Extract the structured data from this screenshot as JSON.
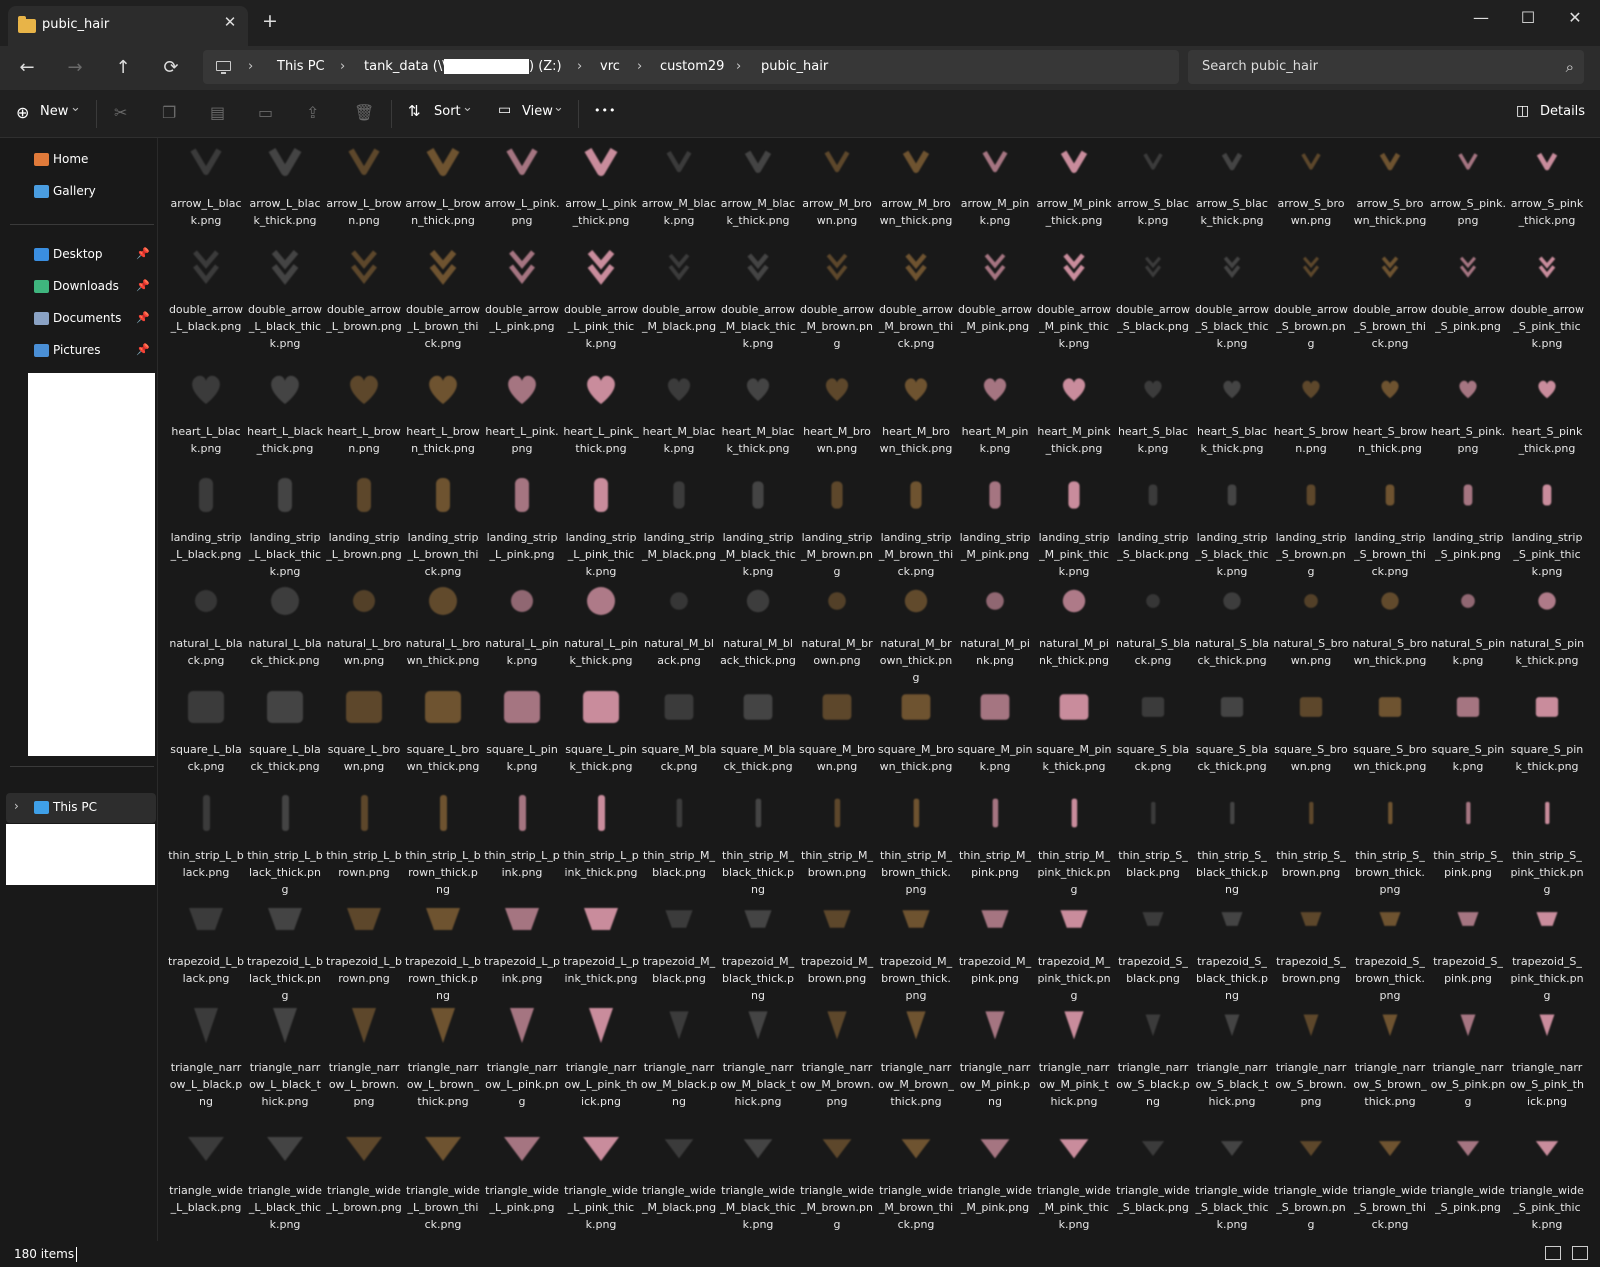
{
  "window": {
    "tab_title": "pubic_hair",
    "new_tab": "+",
    "close_tab": "✕",
    "minimize": "—",
    "maximize": "☐",
    "close": "✕"
  },
  "address_bar": {
    "back": "←",
    "forward": "→",
    "up": "↑",
    "refresh": "⟳",
    "crumbs": [
      "This PC",
      "tank_data (\\\\",
      ") (Z:)",
      "vrc",
      "custom29",
      "pubic_hair"
    ],
    "separator": "›",
    "search_placeholder": "Search pubic_hair",
    "search_icon": "⌕"
  },
  "toolbar": {
    "new_label": "New",
    "sort_label": "Sort",
    "view_label": "View",
    "more_label": "•••",
    "details_label": "Details",
    "caret": "⌄",
    "icons": [
      "cut-icon",
      "copy-icon",
      "paste-icon",
      "rename-icon",
      "share-icon",
      "delete-icon"
    ]
  },
  "sidebar": {
    "items": [
      {
        "label": "Home",
        "color": "#e07a3a",
        "pinned": false
      },
      {
        "label": "Gallery",
        "color": "#4a9de0",
        "pinned": false
      },
      {
        "label": "Desktop",
        "color": "#3a8ee0",
        "pinned": true
      },
      {
        "label": "Downloads",
        "color": "#3fb57e",
        "pinned": true
      },
      {
        "label": "Documents",
        "color": "#8aa2c4",
        "pinned": true
      },
      {
        "label": "Pictures",
        "color": "#4a8fd6",
        "pinned": true
      }
    ],
    "pin_glyph": "📌",
    "this_pc_label": "This PC",
    "expand_glyph": "›"
  },
  "colors": {
    "black": "#444444",
    "brown": "#6e5330",
    "pink": "#c98c9c"
  },
  "files": [
    [
      "arrow_L_black.png",
      "arrow_L_black_thick.png",
      "arrow_L_brown.png",
      "arrow_L_brown_thick.png",
      "arrow_L_pink.png",
      "arrow_L_pink_thick.png",
      "arrow_M_black.png",
      "arrow_M_black_thick.png",
      "arrow_M_brown.png",
      "arrow_M_brown_thick.png",
      "arrow_M_pink.png",
      "arrow_M_pink_thick.png",
      "arrow_S_black.png",
      "arrow_S_black_thick.png",
      "arrow_S_brown.png",
      "arrow_S_brown_thick.png",
      "arrow_S_pink.png",
      "arrow_S_pink_thick.png"
    ],
    [
      "double_arrow_L_black.png",
      "double_arrow_L_black_thick.png",
      "double_arrow_L_brown.png",
      "double_arrow_L_brown_thick.png",
      "double_arrow_L_pink.png",
      "double_arrow_L_pink_thick.png",
      "double_arrow_M_black.png",
      "double_arrow_M_black_thick.png",
      "double_arrow_M_brown.png",
      "double_arrow_M_brown_thick.png",
      "double_arrow_M_pink.png",
      "double_arrow_M_pink_thick.png",
      "double_arrow_S_black.png",
      "double_arrow_S_black_thick.png",
      "double_arrow_S_brown.png",
      "double_arrow_S_brown_thick.png",
      "double_arrow_S_pink.png",
      "double_arrow_S_pink_thick.png"
    ],
    [
      "heart_L_black.png",
      "heart_L_black_thick.png",
      "heart_L_brown.png",
      "heart_L_brown_thick.png",
      "heart_L_pink.png",
      "heart_L_pink_thick.png",
      "heart_M_black.png",
      "heart_M_black_thick.png",
      "heart_M_brown.png",
      "heart_M_brown_thick.png",
      "heart_M_pink.png",
      "heart_M_pink_thick.png",
      "heart_S_black.png",
      "heart_S_black_thick.png",
      "heart_S_brown.png",
      "heart_S_brown_thick.png",
      "heart_S_pink.png",
      "heart_S_pink_thick.png"
    ],
    [
      "landing_strip_L_black.png",
      "landing_strip_L_black_thick.png",
      "landing_strip_L_brown.png",
      "landing_strip_L_brown_thick.png",
      "landing_strip_L_pink.png",
      "landing_strip_L_pink_thick.png",
      "landing_strip_M_black.png",
      "landing_strip_M_black_thick.png",
      "landing_strip_M_brown.png",
      "landing_strip_M_brown_thick.png",
      "landing_strip_M_pink.png",
      "landing_strip_M_pink_thick.png",
      "landing_strip_S_black.png",
      "landing_strip_S_black_thick.png",
      "landing_strip_S_brown.png",
      "landing_strip_S_brown_thick.png",
      "landing_strip_S_pink.png",
      "landing_strip_S_pink_thick.png"
    ],
    [
      "natural_L_black.png",
      "natural_L_black_thick.png",
      "natural_L_brown.png",
      "natural_L_brown_thick.png",
      "natural_L_pink.png",
      "natural_L_pink_thick.png",
      "natural_M_black.png",
      "natural_M_black_thick.png",
      "natural_M_brown.png",
      "natural_M_brown_thick.png",
      "natural_M_pink.png",
      "natural_M_pink_thick.png",
      "natural_S_black.png",
      "natural_S_black_thick.png",
      "natural_S_brown.png",
      "natural_S_brown_thick.png",
      "natural_S_pink.png",
      "natural_S_pink_thick.png"
    ],
    [
      "square_L_black.png",
      "square_L_black_thick.png",
      "square_L_brown.png",
      "square_L_brown_thick.png",
      "square_L_pink.png",
      "square_L_pink_thick.png",
      "square_M_black.png",
      "square_M_black_thick.png",
      "square_M_brown.png",
      "square_M_brown_thick.png",
      "square_M_pink.png",
      "square_M_pink_thick.png",
      "square_S_black.png",
      "square_S_black_thick.png",
      "square_S_brown.png",
      "square_S_brown_thick.png",
      "square_S_pink.png",
      "square_S_pink_thick.png"
    ],
    [
      "thin_strip_L_black.png",
      "thin_strip_L_black_thick.png",
      "thin_strip_L_brown.png",
      "thin_strip_L_brown_thick.png",
      "thin_strip_L_pink.png",
      "thin_strip_L_pink_thick.png",
      "thin_strip_M_black.png",
      "thin_strip_M_black_thick.png",
      "thin_strip_M_brown.png",
      "thin_strip_M_brown_thick.png",
      "thin_strip_M_pink.png",
      "thin_strip_M_pink_thick.png",
      "thin_strip_S_black.png",
      "thin_strip_S_black_thick.png",
      "thin_strip_S_brown.png",
      "thin_strip_S_brown_thick.png",
      "thin_strip_S_pink.png",
      "thin_strip_S_pink_thick.png"
    ],
    [
      "trapezoid_L_black.png",
      "trapezoid_L_black_thick.png",
      "trapezoid_L_brown.png",
      "trapezoid_L_brown_thick.png",
      "trapezoid_L_pink.png",
      "trapezoid_L_pink_thick.png",
      "trapezoid_M_black.png",
      "trapezoid_M_black_thick.png",
      "trapezoid_M_brown.png",
      "trapezoid_M_brown_thick.png",
      "trapezoid_M_pink.png",
      "trapezoid_M_pink_thick.png",
      "trapezoid_S_black.png",
      "trapezoid_S_black_thick.png",
      "trapezoid_S_brown.png",
      "trapezoid_S_brown_thick.png",
      "trapezoid_S_pink.png",
      "trapezoid_S_pink_thick.png"
    ],
    [
      "triangle_narrow_L_black.png",
      "triangle_narrow_L_black_thick.png",
      "triangle_narrow_L_brown.png",
      "triangle_narrow_L_brown_thick.png",
      "triangle_narrow_L_pink.png",
      "triangle_narrow_L_pink_thick.png",
      "triangle_narrow_M_black.png",
      "triangle_narrow_M_black_thick.png",
      "triangle_narrow_M_brown.png",
      "triangle_narrow_M_brown_thick.png",
      "triangle_narrow_M_pink.png",
      "triangle_narrow_M_pink_thick.png",
      "triangle_narrow_S_black.png",
      "triangle_narrow_S_black_thick.png",
      "triangle_narrow_S_brown.png",
      "triangle_narrow_S_brown_thick.png",
      "triangle_narrow_S_pink.png",
      "triangle_narrow_S_pink_thick.png"
    ],
    [
      "triangle_wide_L_black.png",
      "triangle_wide_L_black_thick.png",
      "triangle_wide_L_brown.png",
      "triangle_wide_L_brown_thick.png",
      "triangle_wide_L_pink.png",
      "triangle_wide_L_pink_thick.png",
      "triangle_wide_M_black.png",
      "triangle_wide_M_black_thick.png",
      "triangle_wide_M_brown.png",
      "triangle_wide_M_brown_thick.png",
      "triangle_wide_M_pink.png",
      "triangle_wide_M_pink_thick.png",
      "triangle_wide_S_black.png",
      "triangle_wide_S_black_thick.png",
      "triangle_wide_S_brown.png",
      "triangle_wide_S_brown_thick.png",
      "triangle_wide_S_pink.png",
      "triangle_wide_S_pink_thick.png"
    ]
  ],
  "status": {
    "item_count": "180 items"
  }
}
